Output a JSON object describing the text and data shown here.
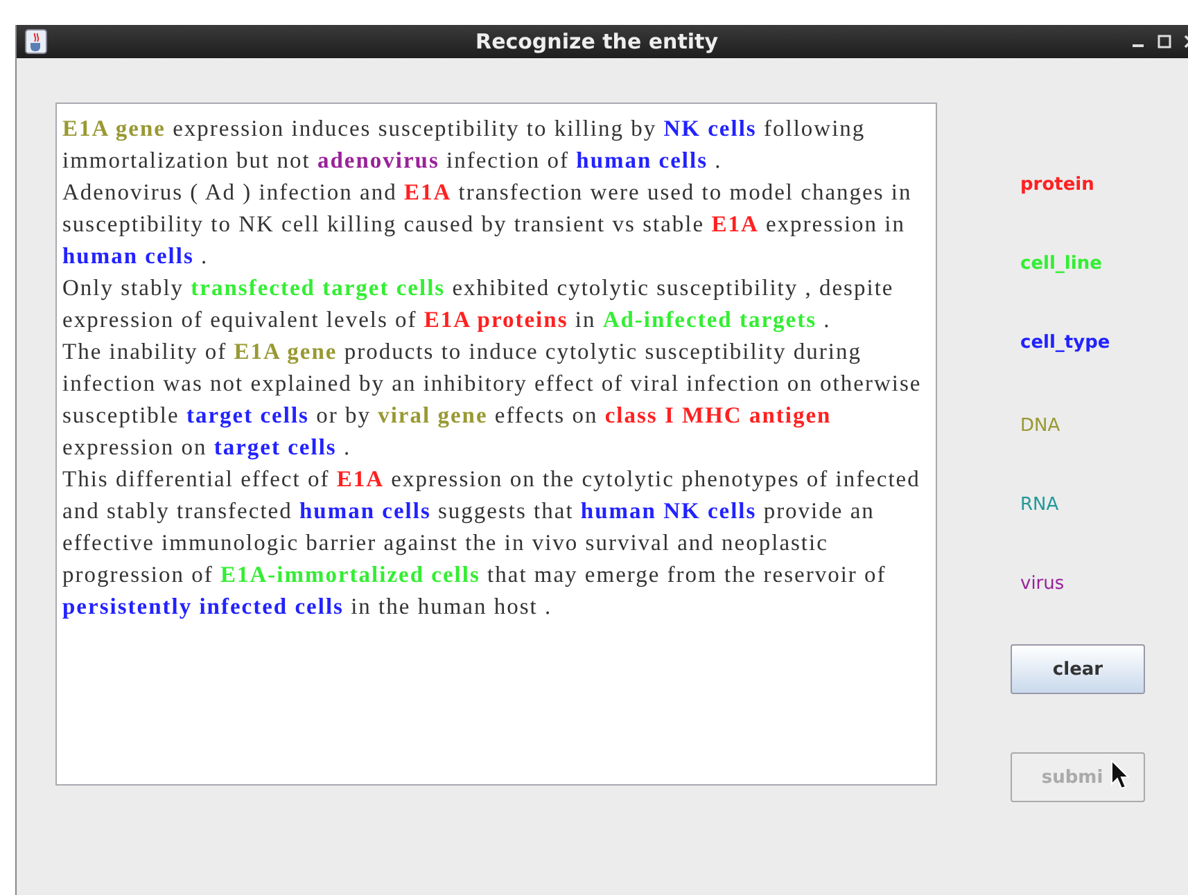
{
  "window": {
    "title": "Recognize the entity"
  },
  "text": [
    [
      {
        "t": "E1A gene",
        "kind": "DNA"
      },
      {
        "t": " expression induces susceptibility to killing by "
      },
      {
        "t": "NK cells",
        "kind": "cell_type"
      },
      {
        "t": " following immortalization but not "
      },
      {
        "t": "adenovirus",
        "kind": "virus"
      },
      {
        "t": " infection of "
      },
      {
        "t": "human cells",
        "kind": "cell_type"
      },
      {
        "t": " ."
      }
    ],
    [
      {
        "t": "Adenovirus ( Ad ) infection and "
      },
      {
        "t": "E1A",
        "kind": "protein"
      },
      {
        "t": " transfection were used to model changes in susceptibility to NK cell killing caused by transient vs stable "
      },
      {
        "t": "E1A",
        "kind": "protein"
      },
      {
        "t": " expression in "
      },
      {
        "t": "human cells",
        "kind": "cell_type"
      },
      {
        "t": " ."
      }
    ],
    [
      {
        "t": "Only stably "
      },
      {
        "t": "transfected target cells",
        "kind": "cell_line"
      },
      {
        "t": " exhibited cytolytic susceptibility , despite expression of equivalent levels of "
      },
      {
        "t": "E1A proteins",
        "kind": "protein"
      },
      {
        "t": " in "
      },
      {
        "t": "Ad-infected targets",
        "kind": "cell_line"
      },
      {
        "t": " ."
      }
    ],
    [
      {
        "t": "The inability of "
      },
      {
        "t": "E1A gene",
        "kind": "DNA"
      },
      {
        "t": " products to induce cytolytic susceptibility during infection was not explained by an inhibitory effect of viral infection on otherwise susceptible "
      },
      {
        "t": "target cells",
        "kind": "cell_type"
      },
      {
        "t": " or by "
      },
      {
        "t": "viral gene",
        "kind": "DNA"
      },
      {
        "t": " effects on "
      },
      {
        "t": "class I MHC antigen",
        "kind": "protein"
      },
      {
        "t": " expression on "
      },
      {
        "t": "target cells",
        "kind": "cell_type"
      },
      {
        "t": " ."
      }
    ],
    [
      {
        "t": "This differential effect of "
      },
      {
        "t": "E1A",
        "kind": "protein"
      },
      {
        "t": " expression on the cytolytic phenotypes of infected and stably transfected "
      },
      {
        "t": "human cells",
        "kind": "cell_type"
      },
      {
        "t": " suggests that "
      },
      {
        "t": "human NK cells",
        "kind": "cell_type"
      },
      {
        "t": " provide an effective immunologic barrier against the in vivo survival and neoplastic progression of "
      },
      {
        "t": "E1A-immortalized cells",
        "kind": "cell_line"
      },
      {
        "t": " that may emerge from the reservoir of "
      },
      {
        "t": "persistently infected cells",
        "kind": "cell_type"
      },
      {
        "t": " in the human host ."
      }
    ]
  ],
  "legend": [
    {
      "label": "protein",
      "kind": "protein",
      "color": "#ff2020"
    },
    {
      "label": "cell_line",
      "kind": "cell_line",
      "color": "#33ee33"
    },
    {
      "label": "cell_type",
      "kind": "cell_type",
      "color": "#2222ff"
    },
    {
      "label": "DNA",
      "kind": "DNA",
      "color": "#999933"
    },
    {
      "label": "RNA",
      "kind": "RNA",
      "color": "#229999"
    },
    {
      "label": "virus",
      "kind": "virus",
      "color": "#992299"
    }
  ],
  "buttons": [
    {
      "label": "clear",
      "disabled": false
    },
    {
      "label": "submi",
      "disabled": true
    }
  ]
}
